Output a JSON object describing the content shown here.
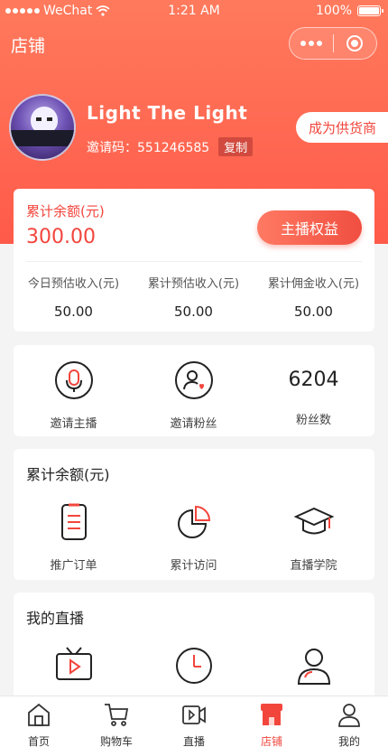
{
  "statusbar": {
    "carrier": "WeChat",
    "time": "1:21 AM",
    "battery": "100%"
  },
  "nav": {
    "title": "店铺"
  },
  "profile": {
    "name": "Light The Light",
    "invite_label": "邀请码：551246585",
    "copy_label": "复制",
    "supplier_label": "成为供货商"
  },
  "balance": {
    "title": "累计余额(元)",
    "amount": "300.00",
    "rights_label": "主播权益",
    "stats": [
      {
        "label": "今日预估收入(元)",
        "value": "50.00"
      },
      {
        "label": "累计预估收入(元)",
        "value": "50.00"
      },
      {
        "label": "累计佣金收入(元)",
        "value": "50.00"
      }
    ]
  },
  "invite_row": {
    "items": [
      {
        "label": "邀请主播",
        "icon": "microphone-icon"
      },
      {
        "label": "邀请粉丝",
        "icon": "user-heart-icon"
      },
      {
        "label": "粉丝数",
        "value": "6204"
      }
    ]
  },
  "section2": {
    "title": "累计余额(元)",
    "items": [
      {
        "label": "推广订单",
        "icon": "order-list-icon"
      },
      {
        "label": "累计访问",
        "icon": "pie-chart-icon"
      },
      {
        "label": "直播学院",
        "icon": "graduation-cap-icon"
      }
    ]
  },
  "section3": {
    "title": "我的直播"
  },
  "tabbar": {
    "items": [
      {
        "label": "首页",
        "icon": "home-icon"
      },
      {
        "label": "购物车",
        "icon": "cart-icon"
      },
      {
        "label": "直播",
        "icon": "video-icon"
      },
      {
        "label": "店铺",
        "icon": "shop-icon",
        "active": true
      },
      {
        "label": "我的",
        "icon": "user-icon"
      }
    ]
  },
  "colors": {
    "accent": "#f2463d",
    "header_top": "#ff7a5c",
    "header_bottom": "#ff5a4a"
  }
}
